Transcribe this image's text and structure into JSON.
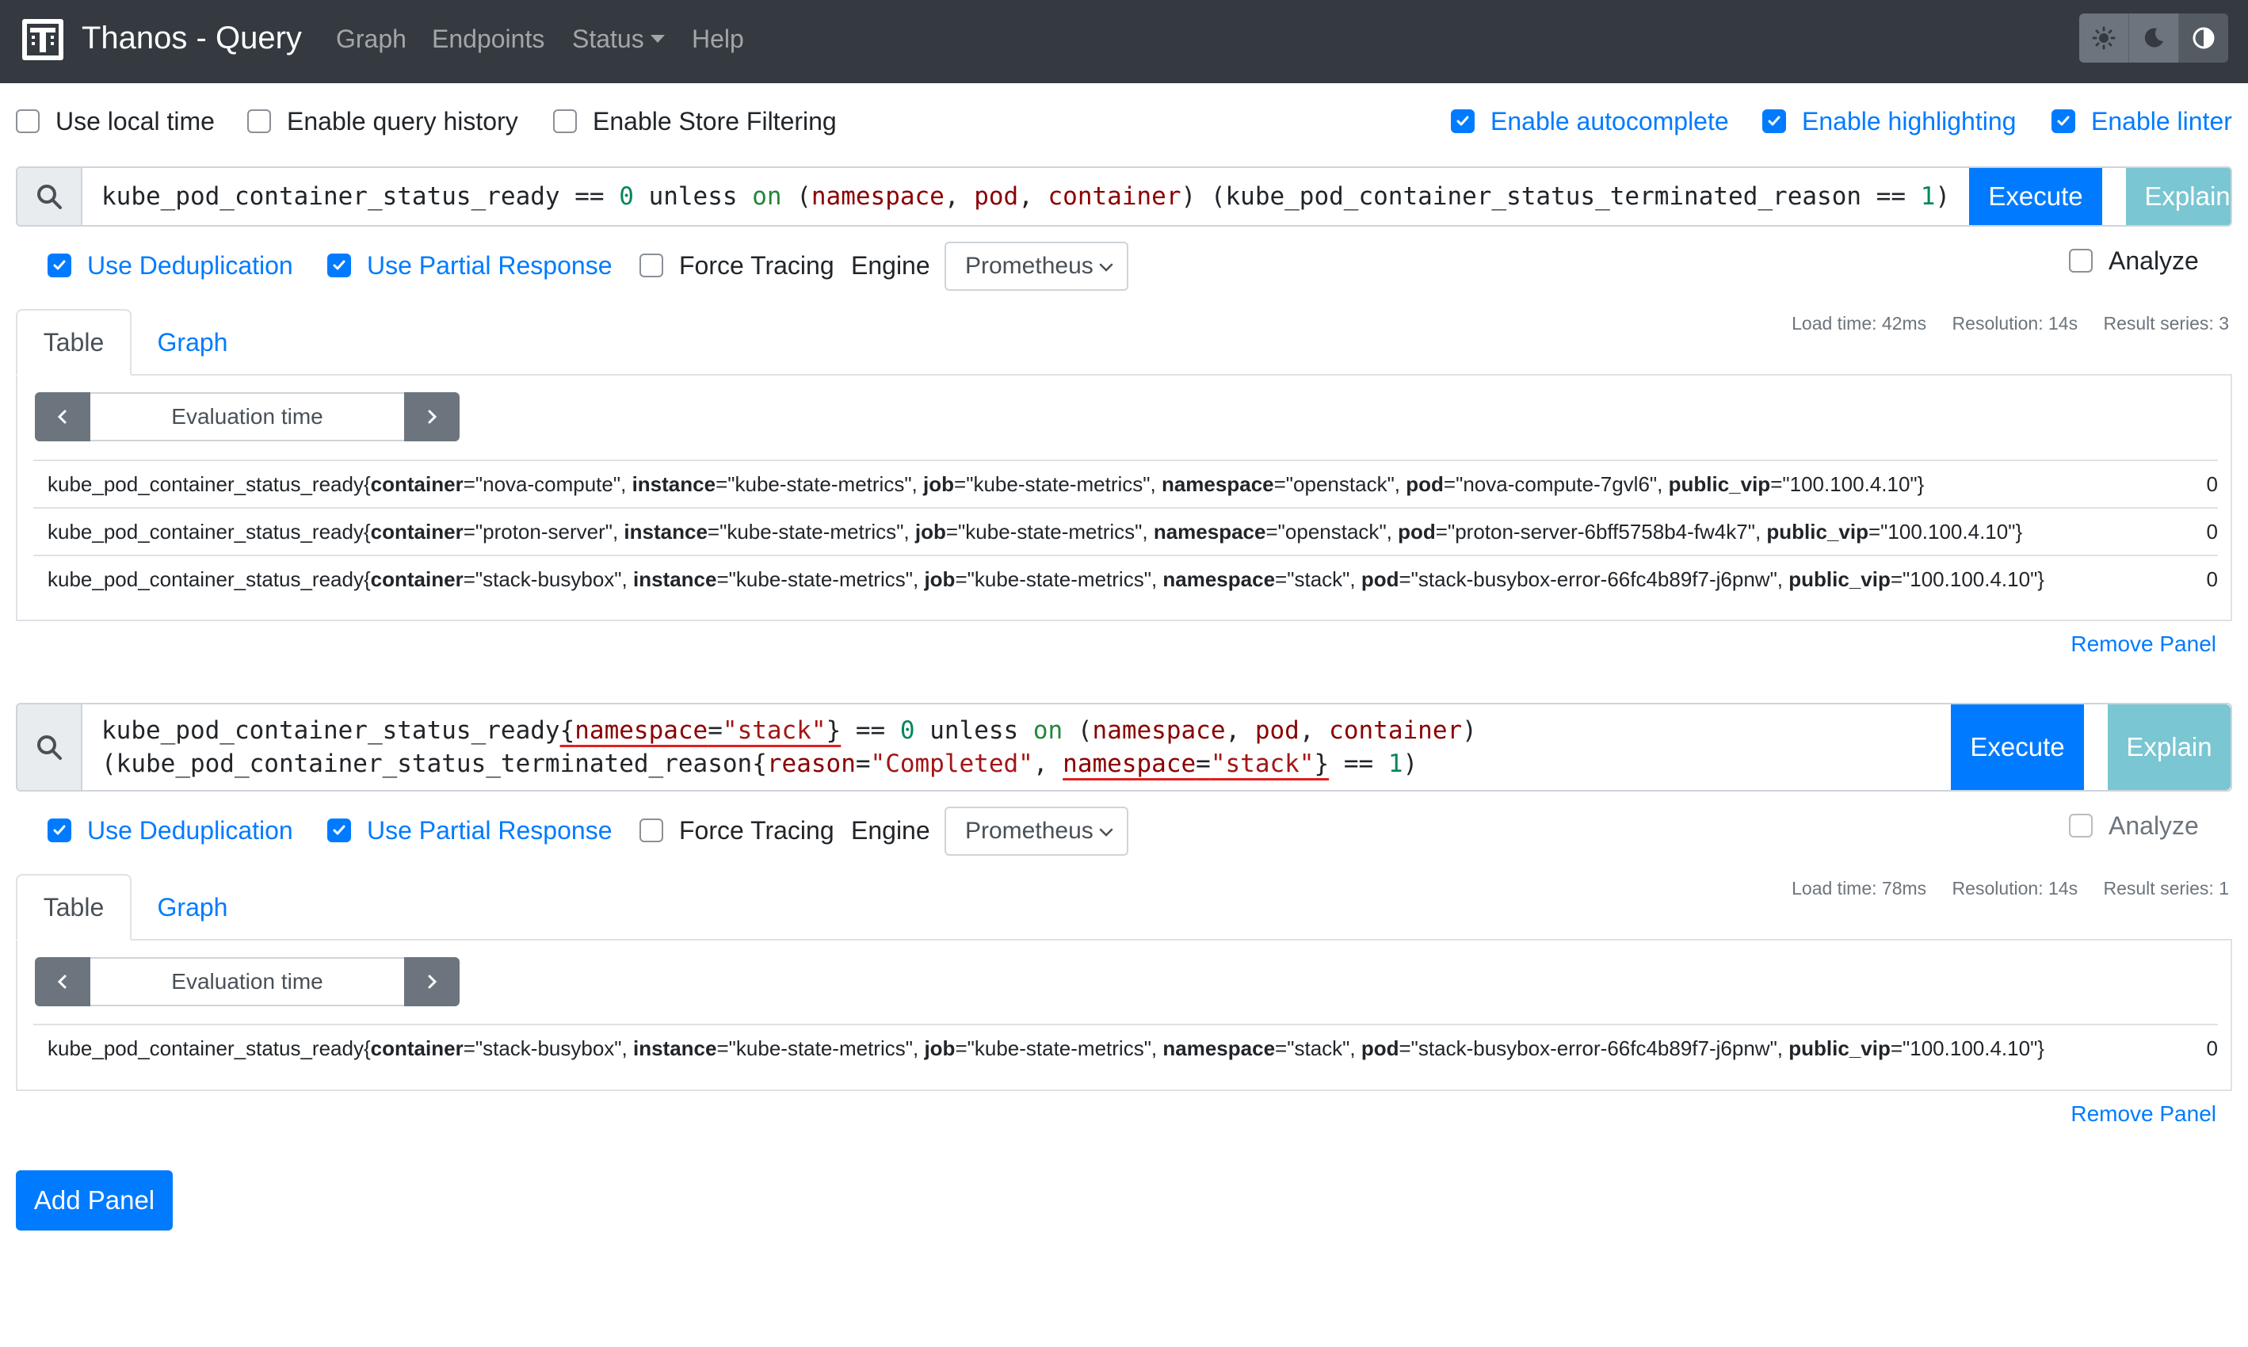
{
  "navbar": {
    "brand": "Thanos - Query",
    "links": [
      "Graph",
      "Endpoints",
      "Status",
      "Help"
    ],
    "theme_icons": [
      "sun-icon",
      "moon-icon",
      "contrast-icon"
    ]
  },
  "settings": {
    "left": [
      {
        "label": "Use local time",
        "checked": false
      },
      {
        "label": "Enable query history",
        "checked": false
      },
      {
        "label": "Enable Store Filtering",
        "checked": false
      }
    ],
    "right": [
      {
        "label": "Enable autocomplete",
        "checked": true
      },
      {
        "label": "Enable highlighting",
        "checked": true
      },
      {
        "label": "Enable linter",
        "checked": true
      }
    ]
  },
  "colors": {
    "primary": "#007bff",
    "navbar": "#343a40",
    "info": "#7ac6d2",
    "underline": "#e01e1e"
  },
  "panels": [
    {
      "query_lines": [
        "kube_pod_container_status_ready == 0 unless on (namespace, pod, container) (kube_pod_container_status_terminated_reason == 1)"
      ],
      "buttons": {
        "execute": "Execute",
        "explain": "Explain"
      },
      "options": {
        "dedup": "Use Deduplication",
        "partial": "Use Partial Response",
        "tracing": "Force Tracing",
        "engine_label": "Engine",
        "engine_value": "Prometheus",
        "analyze": "Analyze"
      },
      "tabs": {
        "table": "Table",
        "graph": "Graph"
      },
      "stats": {
        "load": "Load time: 42ms",
        "resolution": "Resolution: 14s",
        "series": "Result series: 3"
      },
      "eval_placeholder": "Evaluation time",
      "results": [
        {
          "metric": "kube_pod_container_status_ready",
          "labels": [
            [
              "container",
              "nova-compute"
            ],
            [
              "instance",
              "kube-state-metrics"
            ],
            [
              "job",
              "kube-state-metrics"
            ],
            [
              "namespace",
              "openstack"
            ],
            [
              "pod",
              "nova-compute-7gvl6"
            ],
            [
              "public_vip",
              "100.100.4.10"
            ]
          ],
          "value": "0"
        },
        {
          "metric": "kube_pod_container_status_ready",
          "labels": [
            [
              "container",
              "proton-server"
            ],
            [
              "instance",
              "kube-state-metrics"
            ],
            [
              "job",
              "kube-state-metrics"
            ],
            [
              "namespace",
              "openstack"
            ],
            [
              "pod",
              "proton-server-6bff5758b4-fw4k7"
            ],
            [
              "public_vip",
              "100.100.4.10"
            ]
          ],
          "value": "0"
        },
        {
          "metric": "kube_pod_container_status_ready",
          "labels": [
            [
              "container",
              "stack-busybox"
            ],
            [
              "instance",
              "kube-state-metrics"
            ],
            [
              "job",
              "kube-state-metrics"
            ],
            [
              "namespace",
              "stack"
            ],
            [
              "pod",
              "stack-busybox-error-66fc4b89f7-j6pnw"
            ],
            [
              "public_vip",
              "100.100.4.10"
            ]
          ],
          "value": "0"
        }
      ],
      "remove": "Remove Panel"
    },
    {
      "query_lines": [
        "kube_pod_container_status_ready{namespace=\"stack\"} == 0 unless on (namespace, pod, container)",
        "(kube_pod_container_status_terminated_reason{reason=\"Completed\", namespace=\"stack\"} == 1)"
      ],
      "buttons": {
        "execute": "Execute",
        "explain": "Explain"
      },
      "options": {
        "dedup": "Use Deduplication",
        "partial": "Use Partial Response",
        "tracing": "Force Tracing",
        "engine_label": "Engine",
        "engine_value": "Prometheus",
        "analyze": "Analyze"
      },
      "tabs": {
        "table": "Table",
        "graph": "Graph"
      },
      "stats": {
        "load": "Load time: 78ms",
        "resolution": "Resolution: 14s",
        "series": "Result series: 1"
      },
      "eval_placeholder": "Evaluation time",
      "results": [
        {
          "metric": "kube_pod_container_status_ready",
          "labels": [
            [
              "container",
              "stack-busybox"
            ],
            [
              "instance",
              "kube-state-metrics"
            ],
            [
              "job",
              "kube-state-metrics"
            ],
            [
              "namespace",
              "stack"
            ],
            [
              "pod",
              "stack-busybox-error-66fc4b89f7-j6pnw"
            ],
            [
              "public_vip",
              "100.100.4.10"
            ]
          ],
          "value": "0"
        }
      ],
      "remove": "Remove Panel"
    }
  ],
  "add_panel": "Add Panel"
}
